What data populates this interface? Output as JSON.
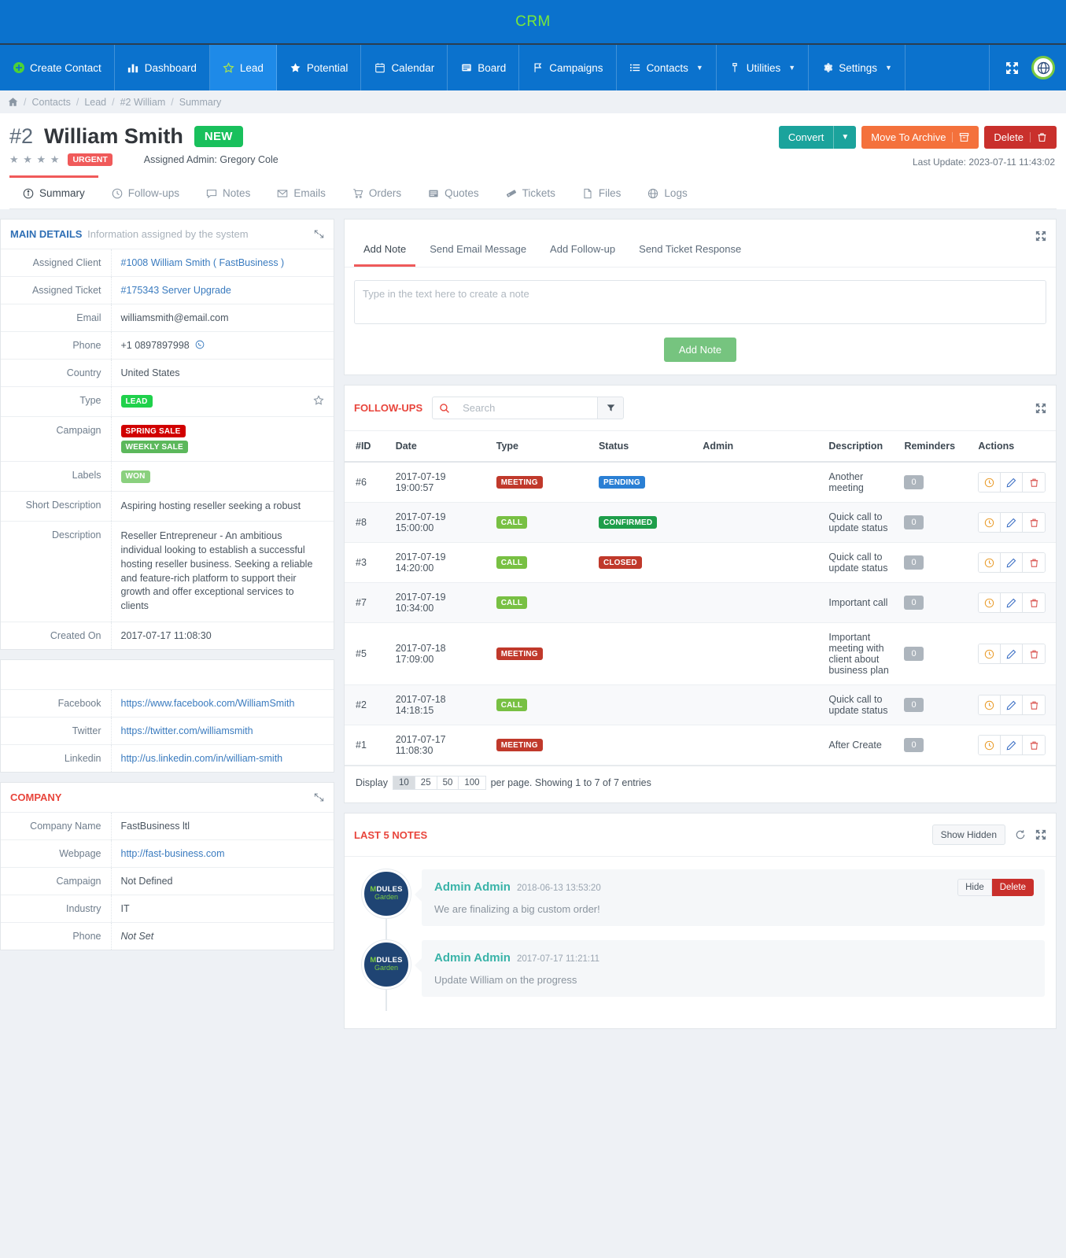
{
  "brand": {
    "title": "CRM"
  },
  "nav": {
    "items": [
      {
        "label": "Create Contact",
        "icon": "plus-circle-icon",
        "active": false
      },
      {
        "label": "Dashboard",
        "icon": "dashboard-icon",
        "active": false
      },
      {
        "label": "Lead",
        "icon": "star-outline-icon",
        "active": true
      },
      {
        "label": "Potential",
        "icon": "star-filled-icon",
        "active": false
      },
      {
        "label": "Calendar",
        "icon": "calendar-icon",
        "active": false
      },
      {
        "label": "Board",
        "icon": "board-icon",
        "active": false
      },
      {
        "label": "Campaigns",
        "icon": "flag-icon",
        "active": false
      },
      {
        "label": "Contacts",
        "icon": "list-icon",
        "active": false,
        "caret": true
      },
      {
        "label": "Utilities",
        "icon": "wrench-icon",
        "active": false,
        "caret": true
      },
      {
        "label": "Settings",
        "icon": "gear-icon",
        "active": false,
        "caret": true
      }
    ],
    "expand_icon": "expand-arrows-icon",
    "logo_icon": "globe-logo-icon"
  },
  "breadcrumb": {
    "home_icon": "home-icon",
    "items": [
      "Contacts",
      "Lead",
      "#2 William",
      "Summary"
    ]
  },
  "header": {
    "record_id": "#2",
    "name": "William Smith",
    "status_badge": "NEW",
    "stars": "★ ★ ★ ★",
    "priority_badge": "URGENT",
    "assigned_admin": "Assigned Admin: Gregory Cole",
    "convert_label": "Convert",
    "archive_label": "Move To Archive",
    "delete_label": "Delete",
    "last_update": "Last Update: 2023-07-11 11:43:02"
  },
  "tabs": [
    {
      "label": "Summary",
      "icon": "info-circle-icon",
      "active": true
    },
    {
      "label": "Follow-ups",
      "icon": "clock-icon",
      "active": false
    },
    {
      "label": "Notes",
      "icon": "comment-icon",
      "active": false
    },
    {
      "label": "Emails",
      "icon": "envelope-icon",
      "active": false
    },
    {
      "label": "Orders",
      "icon": "cart-icon",
      "active": false
    },
    {
      "label": "Quotes",
      "icon": "document-icon",
      "active": false
    },
    {
      "label": "Tickets",
      "icon": "ticket-icon",
      "active": false
    },
    {
      "label": "Files",
      "icon": "file-icon",
      "active": false
    },
    {
      "label": "Logs",
      "icon": "globe-icon",
      "active": false
    }
  ],
  "main_details": {
    "title": "MAIN DETAILS",
    "subtitle": "Information assigned by the system",
    "collapse_icon": "collapse-icon",
    "rows": {
      "assigned_client_label": "Assigned Client",
      "assigned_client_value": "#1008 William Smith ( FastBusiness )",
      "assigned_ticket_label": "Assigned Ticket",
      "assigned_ticket_value": "#175343 Server Upgrade",
      "email_label": "Email",
      "email_value": "williamsmith@email.com",
      "phone_label": "Phone",
      "phone_value": "+1 0897897998",
      "country_label": "Country",
      "country_value": "United States",
      "type_label": "Type",
      "type_value": "LEAD",
      "campaign_label": "Campaign",
      "campaign_value_1": "SPRING SALE",
      "campaign_value_2": "WEEKLY SALE",
      "labels_label": "Labels",
      "labels_value": "WON",
      "short_description_label": "Short Description",
      "short_description_value": "Aspiring hosting reseller seeking a robust",
      "description_label": "Description",
      "description_value": "Reseller Entrepreneur - An ambitious individual looking to establish a successful hosting reseller business. Seeking a reliable and feature-rich platform to support their growth and offer exceptional services to clients",
      "created_on_label": "Created On",
      "created_on_value": "2017-07-17 11:08:30"
    }
  },
  "social": {
    "facebook_label": "Facebook",
    "facebook_value": "https://www.facebook.com/WilliamSmith",
    "twitter_label": "Twitter",
    "twitter_value": "https://twitter.com/williamsmith",
    "linkedin_label": "Linkedin",
    "linkedin_value": "http://us.linkedin.com/in/william-smith"
  },
  "company": {
    "title": "COMPANY",
    "collapse_icon": "collapse-icon",
    "name_label": "Company Name",
    "name_value": "FastBusiness ltl",
    "webpage_label": "Webpage",
    "webpage_value": "http://fast-business.com",
    "campaign_label": "Campaign",
    "campaign_value": "Not Defined",
    "industry_label": "Industry",
    "industry_value": "IT",
    "phone_label": "Phone",
    "phone_value": "Not Set"
  },
  "add_note_panel": {
    "tabs": [
      {
        "label": "Add Note",
        "active": true
      },
      {
        "label": "Send Email Message",
        "active": false
      },
      {
        "label": "Add Follow-up",
        "active": false
      },
      {
        "label": "Send Ticket Response",
        "active": false
      }
    ],
    "textarea_placeholder": "Type in the text here to create a note",
    "submit_label": "Add Note",
    "expand_icon": "expand-icon"
  },
  "followups": {
    "title": "FOLLOW-UPS",
    "search_icon": "search-icon",
    "search_placeholder": "Search",
    "search_value": "",
    "filter_icon": "filter-icon",
    "expand_icon": "expand-icon",
    "columns": [
      "#ID",
      "Date",
      "Type",
      "Status",
      "Admin",
      "Description",
      "Reminders",
      "Actions"
    ],
    "rows": [
      {
        "id": "#6",
        "date": "2017-07-19 19:00:57",
        "type": "MEETING",
        "type_class": "b-meeting",
        "status": "PENDING",
        "status_class": "b-pending",
        "admin": "",
        "description": "Another meeting",
        "reminders": "0"
      },
      {
        "id": "#8",
        "date": "2017-07-19 15:00:00",
        "type": "CALL",
        "type_class": "b-call",
        "status": "CONFIRMED",
        "status_class": "b-confirmed",
        "admin": "",
        "description": "Quick call to update status",
        "reminders": "0"
      },
      {
        "id": "#3",
        "date": "2017-07-19 14:20:00",
        "type": "CALL",
        "type_class": "b-call",
        "status": "CLOSED",
        "status_class": "b-closed",
        "admin": "",
        "description": "Quick call to update status",
        "reminders": "0"
      },
      {
        "id": "#7",
        "date": "2017-07-19 10:34:00",
        "type": "CALL",
        "type_class": "b-call",
        "status": "",
        "status_class": "",
        "admin": "",
        "description": "Important call",
        "reminders": "0"
      },
      {
        "id": "#5",
        "date": "2017-07-18 17:09:00",
        "type": "MEETING",
        "type_class": "b-meeting",
        "status": "",
        "status_class": "",
        "admin": "",
        "description": "Important meeting with client about business plan",
        "reminders": "0"
      },
      {
        "id": "#2",
        "date": "2017-07-18 14:18:15",
        "type": "CALL",
        "type_class": "b-call",
        "status": "",
        "status_class": "",
        "admin": "",
        "description": "Quick call to update status",
        "reminders": "0"
      },
      {
        "id": "#1",
        "date": "2017-07-17 11:08:30",
        "type": "MEETING",
        "type_class": "b-meeting",
        "status": "",
        "status_class": "",
        "admin": "",
        "description": "After Create",
        "reminders": "0"
      }
    ],
    "action_icons": [
      "clock-icon",
      "edit-pencil-icon",
      "trash-icon"
    ],
    "footer_prefix": "Display",
    "page_sizes": [
      "10",
      "25",
      "50",
      "100"
    ],
    "active_page_size": "10",
    "footer_suffix": "per page. Showing 1 to 7 of 7 entries"
  },
  "last_notes": {
    "title": "LAST 5 NOTES",
    "show_hidden_label": "Show Hidden",
    "refresh_icon": "refresh-icon",
    "expand_icon": "expand-icon",
    "avatar_logo_line1": "M",
    "avatar_logo_line1b": "DULES",
    "avatar_logo_line2": "Garden",
    "items": [
      {
        "author": "Admin Admin",
        "time": "2018-06-13 13:53:20",
        "text": "We are finalizing a big custom order!",
        "hide_label": "Hide",
        "delete_label": "Delete"
      },
      {
        "author": "Admin Admin",
        "time": "2017-07-17 11:21:11",
        "text": "Update William on the progress",
        "hide_label": "",
        "delete_label": ""
      }
    ]
  },
  "colors": {
    "primary_blue": "#0b72cd",
    "active_blue": "#1e8ae8",
    "brand_green": "#78e83a",
    "accent_red": "#e8453c",
    "teal": "#1ba39c",
    "orange": "#f4713c",
    "danger": "#c9302c"
  }
}
